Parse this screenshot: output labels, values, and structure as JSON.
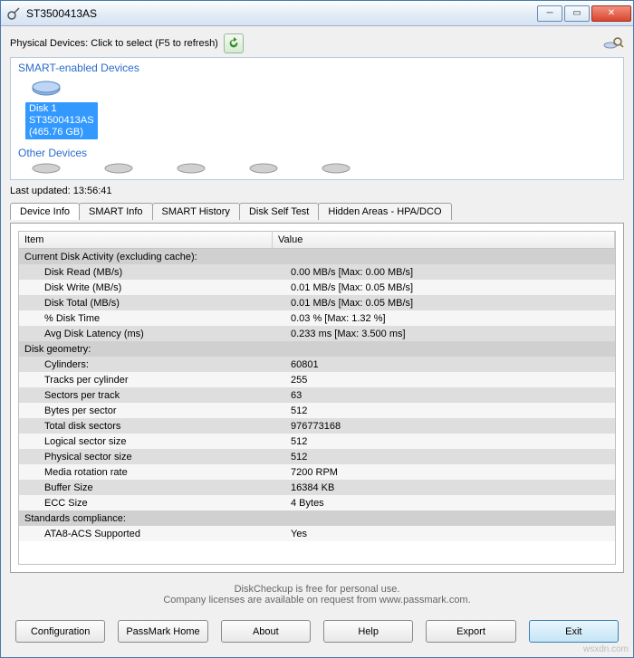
{
  "window": {
    "title": "ST3500413AS"
  },
  "header": {
    "physical_label": "Physical Devices: Click to select (F5 to refresh)",
    "last_updated": "Last updated: 13:56:41"
  },
  "devices": {
    "smart_header": "SMART-enabled Devices",
    "other_header": "Other Devices",
    "selected": {
      "name": "Disk 1",
      "model": "ST3500413AS",
      "size": "(465.76 GB)"
    }
  },
  "tabs": [
    "Device Info",
    "SMART Info",
    "SMART History",
    "Disk Self Test",
    "Hidden Areas - HPA/DCO"
  ],
  "grid": {
    "columns": [
      "Item",
      "Value"
    ],
    "rows": [
      {
        "section": true,
        "item": "Current Disk Activity (excluding cache):",
        "value": ""
      },
      {
        "item": "Disk Read (MB/s)",
        "value": "0.00 MB/s  [Max: 0.00 MB/s]"
      },
      {
        "item": "Disk Write (MB/s)",
        "value": "0.01 MB/s  [Max: 0.05 MB/s]"
      },
      {
        "item": "Disk Total (MB/s)",
        "value": "0.01 MB/s  [Max: 0.05 MB/s]"
      },
      {
        "item": "% Disk Time",
        "value": "0.03 %     [Max: 1.32 %]"
      },
      {
        "item": "Avg Disk Latency (ms)",
        "value": "0.233 ms   [Max: 3.500 ms]"
      },
      {
        "section": true,
        "item": "Disk geometry:",
        "value": ""
      },
      {
        "item": "Cylinders:",
        "value": "60801"
      },
      {
        "item": "Tracks per cylinder",
        "value": "255"
      },
      {
        "item": "Sectors per track",
        "value": "63"
      },
      {
        "item": "Bytes per sector",
        "value": "512"
      },
      {
        "item": "Total disk sectors",
        "value": "976773168"
      },
      {
        "item": "Logical sector size",
        "value": "512"
      },
      {
        "item": "Physical sector size",
        "value": "512"
      },
      {
        "item": "Media rotation rate",
        "value": "7200 RPM"
      },
      {
        "item": "Buffer Size",
        "value": "16384 KB"
      },
      {
        "item": "ECC Size",
        "value": "4 Bytes"
      },
      {
        "section": true,
        "item": "Standards compliance:",
        "value": ""
      },
      {
        "item": "ATA8-ACS Supported",
        "value": "Yes"
      }
    ]
  },
  "footer": {
    "line1": "DiskCheckup is free for personal use.",
    "line2": "Company licenses are available on request from www.passmark.com."
  },
  "buttons": [
    "Configuration",
    "PassMark Home",
    "About",
    "Help",
    "Export",
    "Exit"
  ],
  "watermark": "wsxdn.com"
}
